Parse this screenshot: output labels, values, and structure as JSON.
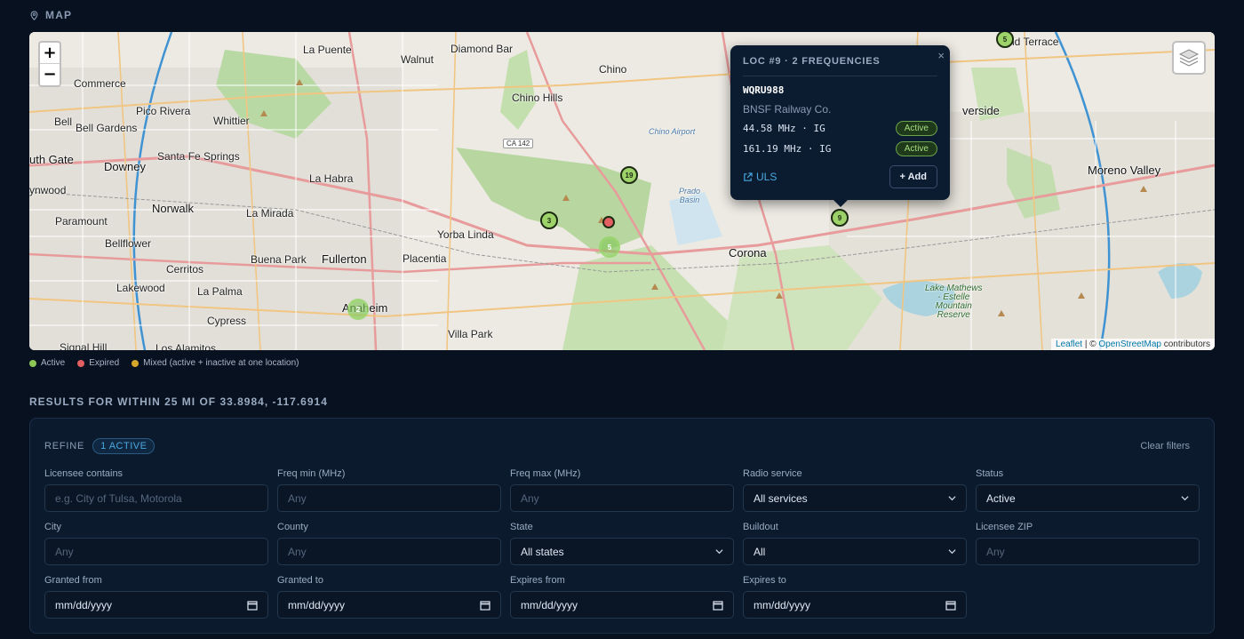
{
  "section": {
    "map_label": "MAP"
  },
  "map": {
    "zoom_in": "+",
    "zoom_out": "−",
    "labels": {
      "la_puente": "La Puente",
      "walnut": "Walnut",
      "diamond_bar": "Diamond Bar",
      "chino": "Chino",
      "chino_hills": "Chino Hills",
      "commerce": "Commerce",
      "pico_rivera": "Pico Rivera",
      "whittier": "Whittier",
      "bell": "Bell",
      "bell_gardens": "Bell Gardens",
      "south_gate": "uth Gate",
      "downey": "Downey",
      "santa_fe_springs": "Santa Fe Springs",
      "lynwood": "ynwood",
      "la_habra": "La Habra",
      "norwalk": "Norwalk",
      "la_mirada": "La Mirada",
      "paramount": "Paramount",
      "yorba_linda": "Yorba Linda",
      "bellflower": "Bellflower",
      "cerritos": "Cerritos",
      "buena_park": "Buena Park",
      "fullerton": "Fullerton",
      "placentia": "Placentia",
      "lakewood": "Lakewood",
      "la_palma": "La Palma",
      "anaheim": "Anaheim",
      "cypress": "Cypress",
      "villa_park": "Villa Park",
      "signal_hill": "Signal Hill",
      "los_alamitos": "Los Alamitos",
      "corona": "Corona",
      "moreno_valley": "Moreno Valley",
      "riverside": "verside",
      "grand_terrace": "nd Terrace",
      "chino_airport": "Chino Airport",
      "prado_basin": "Prado\nBasin",
      "lake_mathews": "Lake Mathews\n- Estelle\nMountain\nReserve"
    },
    "routes": [
      "CA 142"
    ],
    "attribution": {
      "leaflet": "Leaflet",
      "sep": " | © ",
      "osm": "OpenStreetMap",
      "contributors": " contributors"
    },
    "markers": [
      {
        "label": "5",
        "status": "active"
      },
      {
        "label": "19",
        "status": "active"
      },
      {
        "label": "3",
        "status": "active"
      },
      {
        "label": "",
        "status": "expired"
      },
      {
        "label": "5",
        "status": "active"
      },
      {
        "label": "9",
        "status": "active"
      },
      {
        "label": "2",
        "status": "active"
      }
    ]
  },
  "popup": {
    "title": "LOC #9 · 2 FREQUENCIES",
    "close": "×",
    "callsign": "WQRU988",
    "licensee": "BNSF Railway Co.",
    "frequencies": [
      {
        "freq": "44.58 MHz · IG",
        "status": "Active"
      },
      {
        "freq": "161.19 MHz · IG",
        "status": "Active"
      }
    ],
    "uls_label": "ULS",
    "add_label": "Add"
  },
  "legend": [
    {
      "label": "Active",
      "color": "#8cc756"
    },
    {
      "label": "Expired",
      "color": "#e35f62"
    },
    {
      "label": "Mixed (active + inactive at one location)",
      "color": "#d4a72c"
    }
  ],
  "results": {
    "title": "RESULTS FOR WITHIN 25 MI OF 33.8984, -117.6914"
  },
  "refine": {
    "label": "REFINE",
    "active_count": "1 ACTIVE",
    "clear": "Clear filters",
    "fields": {
      "licensee": {
        "label": "Licensee contains",
        "placeholder": "e.g. City of Tulsa, Motorola"
      },
      "freq_min": {
        "label": "Freq min (MHz)",
        "placeholder": "Any"
      },
      "freq_max": {
        "label": "Freq max (MHz)",
        "placeholder": "Any"
      },
      "radio_service": {
        "label": "Radio service",
        "value": "All services"
      },
      "status": {
        "label": "Status",
        "value": "Active"
      },
      "city": {
        "label": "City",
        "placeholder": "Any"
      },
      "county": {
        "label": "County",
        "placeholder": "Any"
      },
      "state": {
        "label": "State",
        "value": "All states"
      },
      "buildout": {
        "label": "Buildout",
        "value": "All"
      },
      "zip": {
        "label": "Licensee ZIP",
        "placeholder": "Any"
      },
      "granted_from": {
        "label": "Granted from",
        "value": "mm/dd/yyyy"
      },
      "granted_to": {
        "label": "Granted to",
        "value": "mm/dd/yyyy"
      },
      "expires_from": {
        "label": "Expires from",
        "value": "mm/dd/yyyy"
      },
      "expires_to": {
        "label": "Expires to",
        "value": "mm/dd/yyyy"
      }
    }
  }
}
